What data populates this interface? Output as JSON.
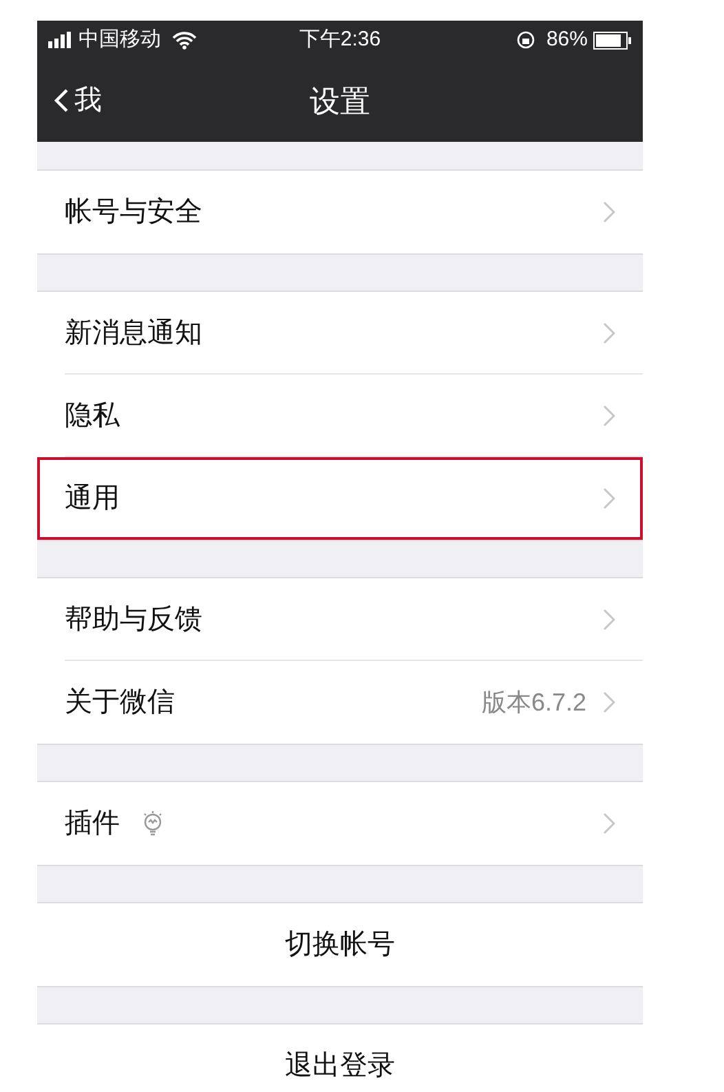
{
  "status_bar": {
    "carrier": "中国移动",
    "time": "下午2:36",
    "battery": "86%"
  },
  "nav_bar": {
    "back": "我",
    "title": "设置"
  },
  "sections": [
    {
      "rows": [
        {
          "kind": "nav",
          "label": "帐号与安全",
          "highlighted": false
        }
      ]
    },
    {
      "rows": [
        {
          "kind": "nav",
          "label": "新消息通知",
          "highlighted": false
        },
        {
          "kind": "nav",
          "label": "隐私",
          "highlighted": false
        },
        {
          "kind": "nav",
          "label": "通用",
          "highlighted": true
        }
      ]
    },
    {
      "rows": [
        {
          "kind": "nav",
          "label": "帮助与反馈",
          "highlighted": false
        },
        {
          "kind": "nav",
          "label": "关于微信",
          "value": "版本6.7.2",
          "highlighted": false
        }
      ]
    },
    {
      "rows": [
        {
          "kind": "nav_icon",
          "label": "插件",
          "highlighted": false
        }
      ]
    },
    {
      "rows": [
        {
          "kind": "action",
          "label": "切换帐号",
          "highlighted": false
        }
      ]
    },
    {
      "rows": [
        {
          "kind": "action",
          "label": "退出登录",
          "highlighted": false
        }
      ]
    }
  ]
}
